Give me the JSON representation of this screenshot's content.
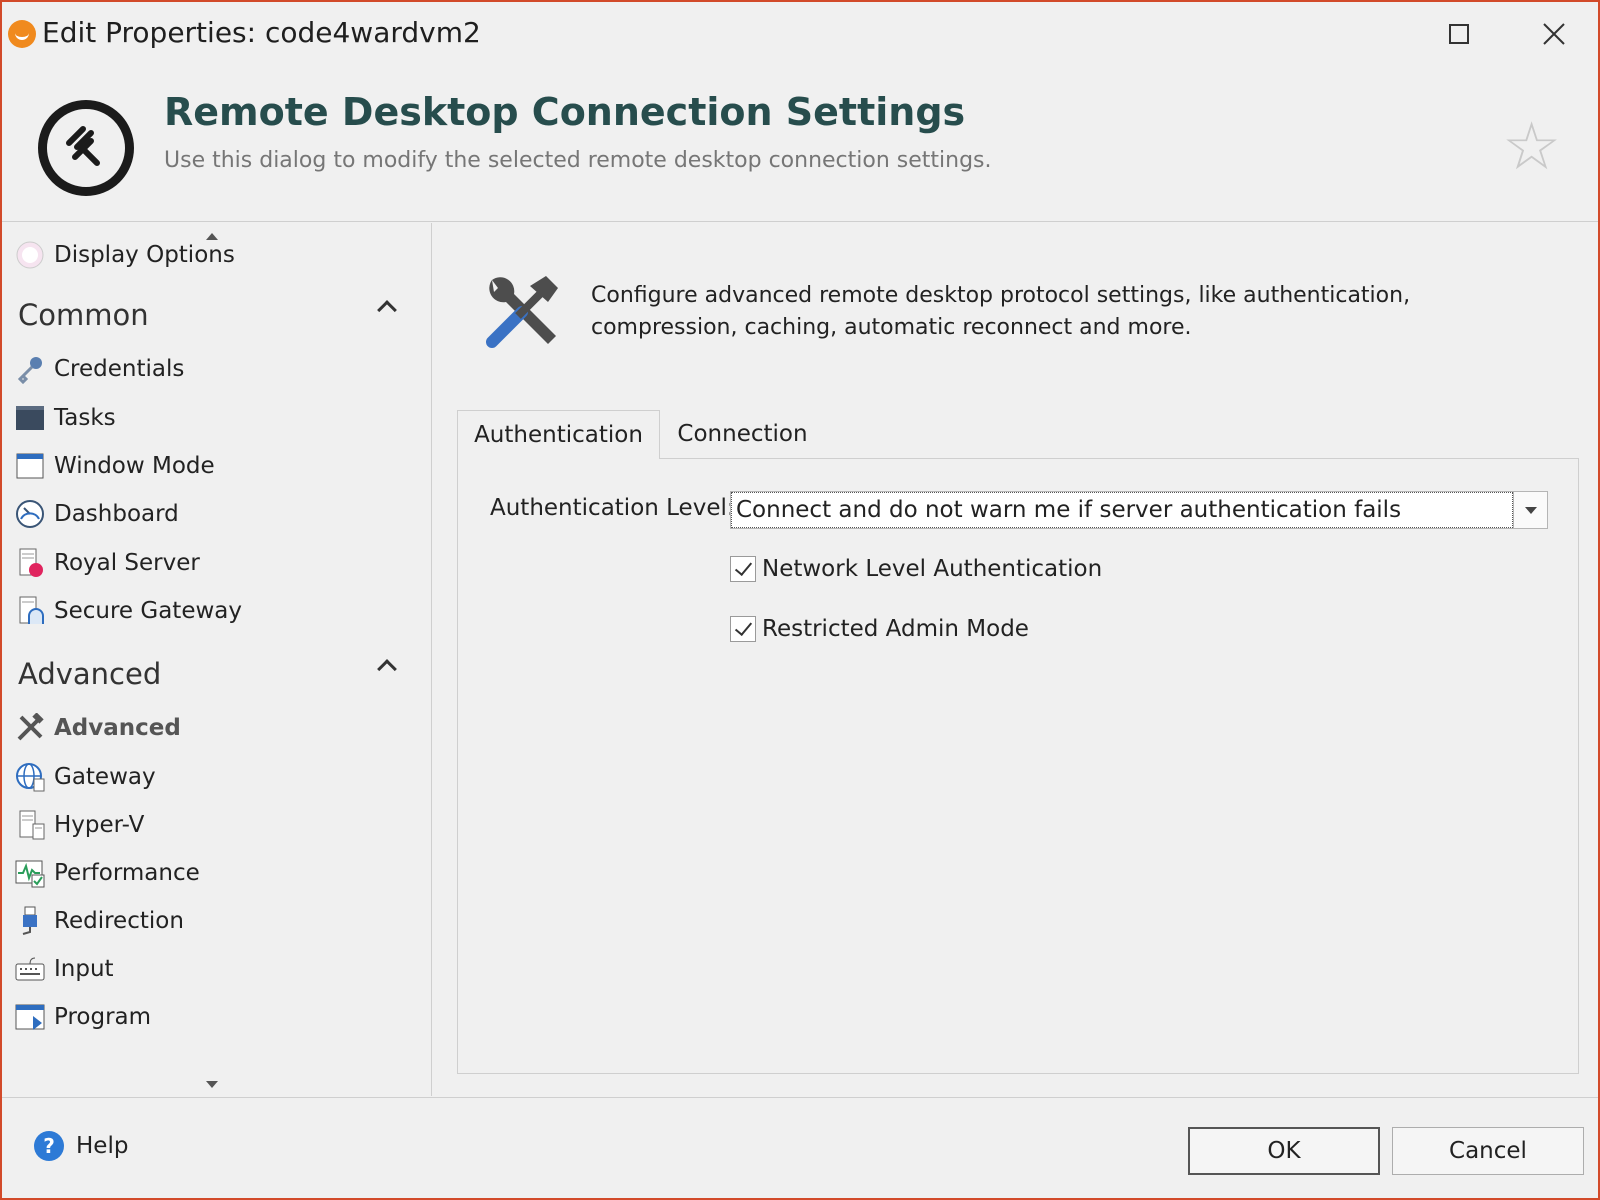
{
  "window": {
    "title": "Edit Properties: code4wardvm2"
  },
  "header": {
    "title": "Remote Desktop Connection Settings",
    "subtitle": "Use this dialog to modify the selected remote desktop connection settings."
  },
  "sidebar": {
    "top_item": {
      "label": "Display Options",
      "icon": "display-options-icon"
    },
    "groups": [
      {
        "title": "Common",
        "items": [
          {
            "label": "Credentials",
            "icon": "key-icon"
          },
          {
            "label": "Tasks",
            "icon": "tasks-icon"
          },
          {
            "label": "Window Mode",
            "icon": "window-icon"
          },
          {
            "label": "Dashboard",
            "icon": "dashboard-icon"
          },
          {
            "label": "Royal Server",
            "icon": "royal-server-icon"
          },
          {
            "label": "Secure Gateway",
            "icon": "secure-gateway-icon"
          }
        ]
      },
      {
        "title": "Advanced",
        "items": [
          {
            "label": "Advanced",
            "icon": "tools-icon",
            "active": true
          },
          {
            "label": "Gateway",
            "icon": "globe-icon"
          },
          {
            "label": "Hyper-V",
            "icon": "server-icon"
          },
          {
            "label": "Performance",
            "icon": "performance-icon"
          },
          {
            "label": "Redirection",
            "icon": "usb-icon"
          },
          {
            "label": "Input",
            "icon": "keyboard-icon"
          },
          {
            "label": "Program",
            "icon": "program-icon"
          }
        ]
      }
    ]
  },
  "content": {
    "description": "Configure advanced remote desktop protocol settings, like authentication, compression, caching, automatic reconnect and more.",
    "tabs": [
      {
        "label": "Authentication",
        "active": true
      },
      {
        "label": "Connection",
        "active": false
      }
    ],
    "auth_level_label": "Authentication Level:",
    "auth_level_value": "Connect and do not warn me if server authentication fails",
    "checkboxes": [
      {
        "label": "Network Level Authentication",
        "checked": true
      },
      {
        "label": "Restricted Admin Mode",
        "checked": true
      }
    ]
  },
  "footer": {
    "help_label": "Help",
    "ok_label": "OK",
    "cancel_label": "Cancel"
  },
  "colors": {
    "accent_title": "#274d4d",
    "window_border": "#d24a2a",
    "help_blue": "#2d7ad6"
  }
}
